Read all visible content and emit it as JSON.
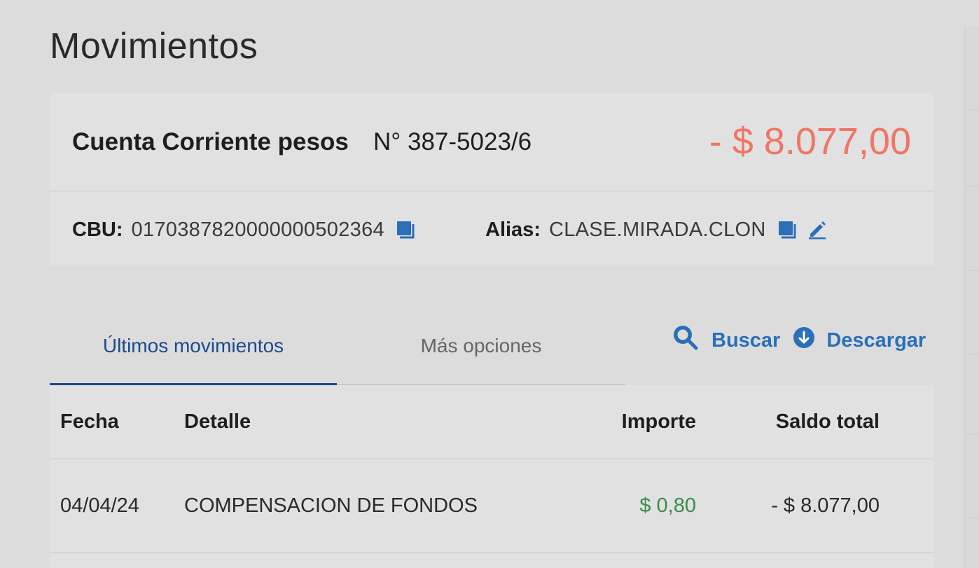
{
  "page": {
    "title": "Movimientos"
  },
  "account": {
    "type": "Cuenta Corriente pesos",
    "number": "N° 387-5023/6",
    "balance": "- $ 8.077,00",
    "cbu_label": "CBU:",
    "cbu_value": "0170387820000000502364",
    "alias_label": "Alias:",
    "alias_value": "CLASE.MIRADA.CLON"
  },
  "tabs": [
    {
      "label": "Últimos movimientos",
      "active": true
    },
    {
      "label": "Más opciones",
      "active": false
    }
  ],
  "actions": {
    "search_label": "Buscar",
    "download_label": "Descargar"
  },
  "table": {
    "columns": [
      "Fecha",
      "Detalle",
      "Importe",
      "Saldo total"
    ],
    "rows": [
      {
        "fecha": "04/04/24",
        "detalle": "COMPENSACION DE FONDOS",
        "importe": "$ 0,80",
        "saldo": "- $ 8.077,00"
      }
    ]
  },
  "colors": {
    "balance_negative": "#f07565",
    "accent_blue": "#2a6fb8",
    "tab_active": "#1b4a8a",
    "amount_positive": "#3c8a4a"
  },
  "icons": {
    "copy_cbu": "copy-icon",
    "copy_alias": "copy-icon",
    "edit_alias": "pencil-icon",
    "search": "search-icon",
    "download": "download-icon"
  }
}
